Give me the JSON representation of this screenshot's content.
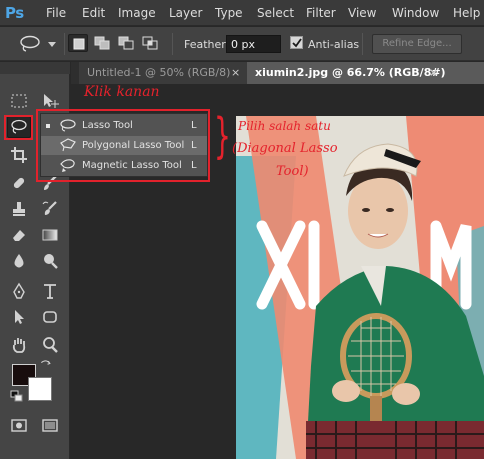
{
  "app": {
    "logo": "Ps"
  },
  "menu": [
    "File",
    "Edit",
    "Image",
    "Layer",
    "Type",
    "Select",
    "Filter",
    "View",
    "Window",
    "Help"
  ],
  "options_bar": {
    "tool_icon": "lasso-icon",
    "selection_modes": [
      "new-selection",
      "add-to-selection",
      "subtract-from-selection",
      "intersect-with-selection"
    ],
    "feather_label": "Feather:",
    "feather_value": "0 px",
    "antialias_label": "Anti-alias",
    "antialias_checked": true,
    "refine_edge_label": "Refine Edge..."
  },
  "tabs": [
    {
      "label": "Untitled-1 @ 50% (RGB/8)",
      "active": false
    },
    {
      "label": "xiumin2.jpg @ 66.7% (RGB/8#)",
      "active": true
    }
  ],
  "context_menu": {
    "items": [
      {
        "label": "Lasso Tool",
        "shortcut": "L",
        "icon": "lasso-icon",
        "current": true
      },
      {
        "label": "Polygonal Lasso Tool",
        "shortcut": "L",
        "icon": "polygonal-lasso-icon",
        "current": false
      },
      {
        "label": "Magnetic Lasso Tool",
        "shortcut": "L",
        "icon": "magnetic-lasso-icon",
        "current": false
      }
    ]
  },
  "annotations": {
    "right_click": "Klik kanan",
    "brace": "}",
    "choose_one": "Pilih salah satu",
    "choice_line1": "(Diagonal Lasso",
    "choice_line2": "Tool)"
  },
  "photo": {
    "text": "XIUMIN"
  },
  "colors": {
    "foreground": "#180d0d",
    "background": "#ffffff",
    "annotation": "#e2222c",
    "accent_logo": "#4ea6e6"
  }
}
